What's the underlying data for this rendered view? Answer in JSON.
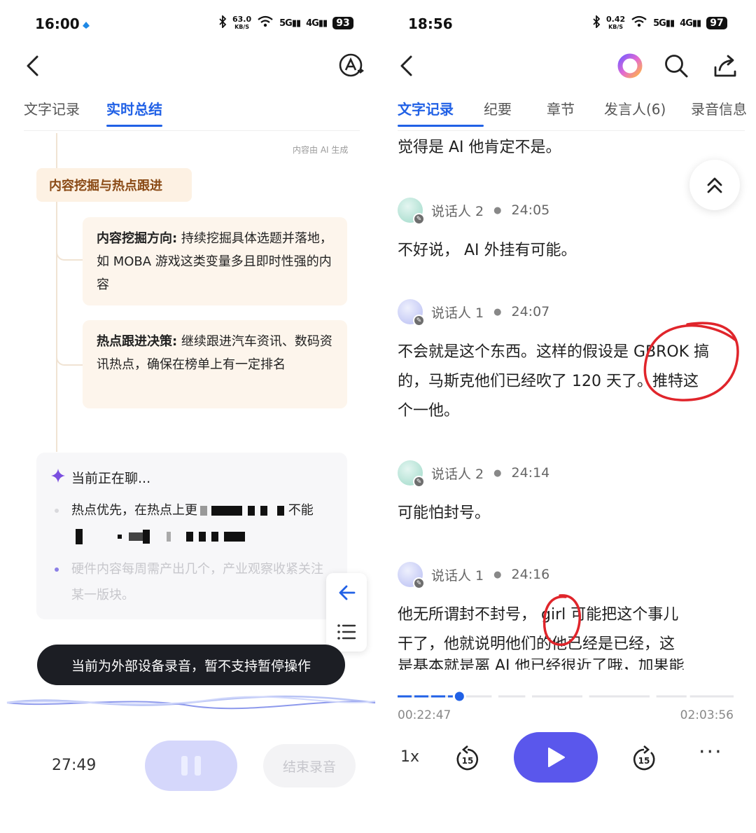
{
  "left": {
    "status": {
      "time": "16:00",
      "net_speed": "63.0",
      "net_unit": "KB/S",
      "sig1": "5G",
      "sig2": "4G",
      "battery": "93"
    },
    "tabs": [
      "文字记录",
      "实时总结"
    ],
    "ai_note": "内容由 AI 生成",
    "section_title": "内容挖掘与热点跟进",
    "cards": [
      {
        "label": "内容挖掘方向:",
        "text": " 持续挖掘具体选题并落地，如 MOBA 游戏这类变量多且即时性强的内容"
      },
      {
        "label": "热点跟进决策:",
        "text": " 继续跟进汽车资讯、数码资讯热点，确保在榜单上有一定排名"
      }
    ],
    "now_chatting": {
      "title": "当前正在聊...",
      "item1_start": "热点优先，在热点上更",
      "item1_end": "不能",
      "item2": "硬件内容每周需产出几个，产业观察收紧关注某一版块。"
    },
    "toast": "当前为外部设备录音，暂不支持暂停操作",
    "record_time": "27:49",
    "end_label": "结束录音",
    "colors": {
      "accent": "#2161e6",
      "chip_bg": "#fdf1e3",
      "chip_text": "#8a4a16",
      "toast_bg": "#1c1e24",
      "pause_bg": "#d5d7fb"
    }
  },
  "right": {
    "status": {
      "time": "18:56",
      "net_speed": "0.42",
      "net_unit": "KB/S",
      "sig1": "5G",
      "sig2": "4G",
      "battery": "97"
    },
    "tabs": [
      "文字记录",
      "纪要",
      "章节",
      "发言人(6)",
      "录音信息"
    ],
    "top_line": "觉得是 AI 他肯定不是。",
    "entries": [
      {
        "speaker": "说话人 2",
        "time": "24:05",
        "lines": [
          "不好说， AI 外挂有可能。"
        ]
      },
      {
        "speaker": "说话人 1",
        "time": "24:07",
        "lines": [
          "不会就是这个东西。这样的假设是 GBROK 搞",
          "的，马斯克他们已经吹了 120 天了。推特这",
          "个一他。"
        ]
      },
      {
        "speaker": "说话人 2",
        "time": "24:14",
        "lines": [
          "可能怕封号。"
        ]
      },
      {
        "speaker": "说话人 1",
        "time": "24:16",
        "lines": [
          "他无所谓封不封号， girl 可能把这个事儿",
          "干了，他就说明他们的他已经是已经，这"
        ]
      }
    ],
    "faded_line": "是基本就是离 AI 他已经很近了哦，加果能",
    "progress": {
      "current": "00:22:47",
      "total": "02:03:56",
      "fraction": 0.184
    },
    "speed": "1x",
    "skip_back": "15",
    "skip_forward": "15",
    "colors": {
      "accent": "#2161e6",
      "play_bg": "#5a57ec",
      "annotation_red": "#e0252b",
      "avatar_speaker1": "#c9cdf6",
      "avatar_speaker2": "#bfe7dc"
    }
  }
}
